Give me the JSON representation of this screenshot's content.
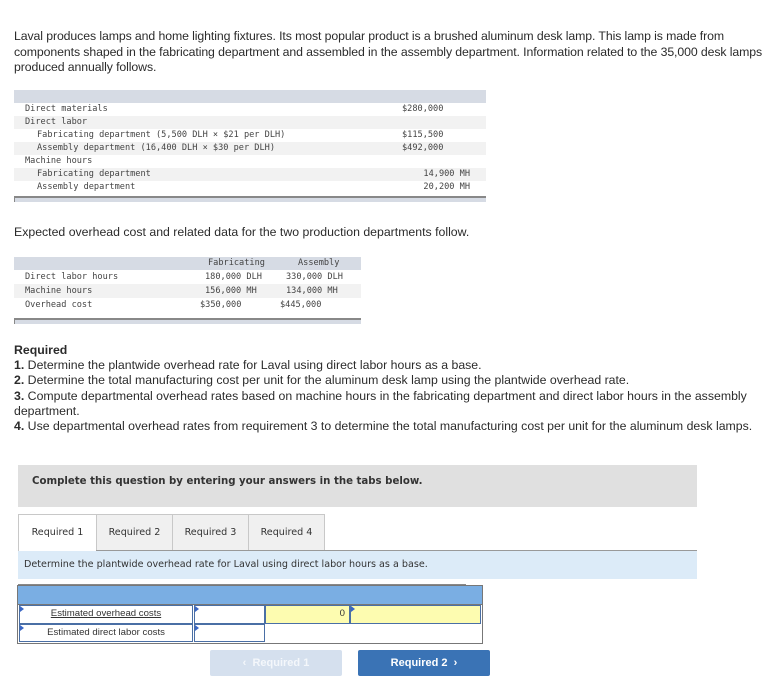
{
  "intro": "Laval produces lamps and home lighting fixtures. Its most popular product is a brushed aluminum desk lamp. This lamp is made from components shaped in the fabricating department and assembled in the assembly department. Information related to the 35,000 desk lamps produced annually follows.",
  "table1": {
    "rows": [
      {
        "label": "Direct materials",
        "indent": false,
        "value": "$280,000"
      },
      {
        "label": "Direct labor",
        "indent": false,
        "value": ""
      },
      {
        "label": "Fabricating department (5,500 DLH × $21 per DLH)",
        "indent": true,
        "value": "$115,500"
      },
      {
        "label": "Assembly department (16,400 DLH × $30 per DLH)",
        "indent": true,
        "value": "$492,000"
      },
      {
        "label": "Machine hours",
        "indent": false,
        "value": ""
      },
      {
        "label": "Fabricating department",
        "indent": true,
        "value": "14,900 MH"
      },
      {
        "label": "Assembly department",
        "indent": true,
        "value": "20,200 MH"
      }
    ]
  },
  "expected_text": "Expected overhead cost and related data for the two production departments follow.",
  "table2": {
    "headers": [
      "",
      "Fabricating",
      "Assembly"
    ],
    "rows": [
      [
        "Direct labor hours",
        "180,000 DLH",
        "330,000 DLH"
      ],
      [
        "Machine hours",
        "156,000 MH",
        "134,000 MH"
      ],
      [
        "Overhead cost",
        "$350,000",
        "$445,000"
      ]
    ]
  },
  "required": {
    "title": "Required",
    "items": [
      {
        "num": "1.",
        "text": " Determine the plantwide overhead rate for Laval using direct labor hours as a base."
      },
      {
        "num": "2.",
        "text": " Determine the total manufacturing cost per unit for the aluminum desk lamp using the plantwide overhead rate."
      },
      {
        "num": "3.",
        "text": " Compute departmental overhead rates based on machine hours in the fabricating department and direct labor hours in the assembly department."
      },
      {
        "num": "4.",
        "text": " Use departmental overhead rates from requirement 3 to determine the total manufacturing cost per unit for the aluminum desk lamps."
      }
    ]
  },
  "banner": "Complete this question by entering your answers in the tabs below.",
  "tabs": [
    "Required 1",
    "Required 2",
    "Required 3",
    "Required 4"
  ],
  "active_tab": "Required 1",
  "instruction": "Determine the plantwide overhead rate for Laval using direct labor hours as a base.",
  "grid": {
    "row1_label": "Estimated overhead costs",
    "row1_input": "",
    "row1_result": "0",
    "row1_result2": "",
    "row2_label": "Estimated direct labor costs",
    "row2_input": ""
  },
  "nav": {
    "prev_label": "Required 1",
    "next_label": "Required 2",
    "prev_icon": "‹",
    "next_icon": "›"
  },
  "colors": {
    "header_blue": "#7aaee3",
    "answer_yellow": "#fdfcb0",
    "next_button": "#3a73b5",
    "prev_button_disabled": "#d5e0ee"
  }
}
